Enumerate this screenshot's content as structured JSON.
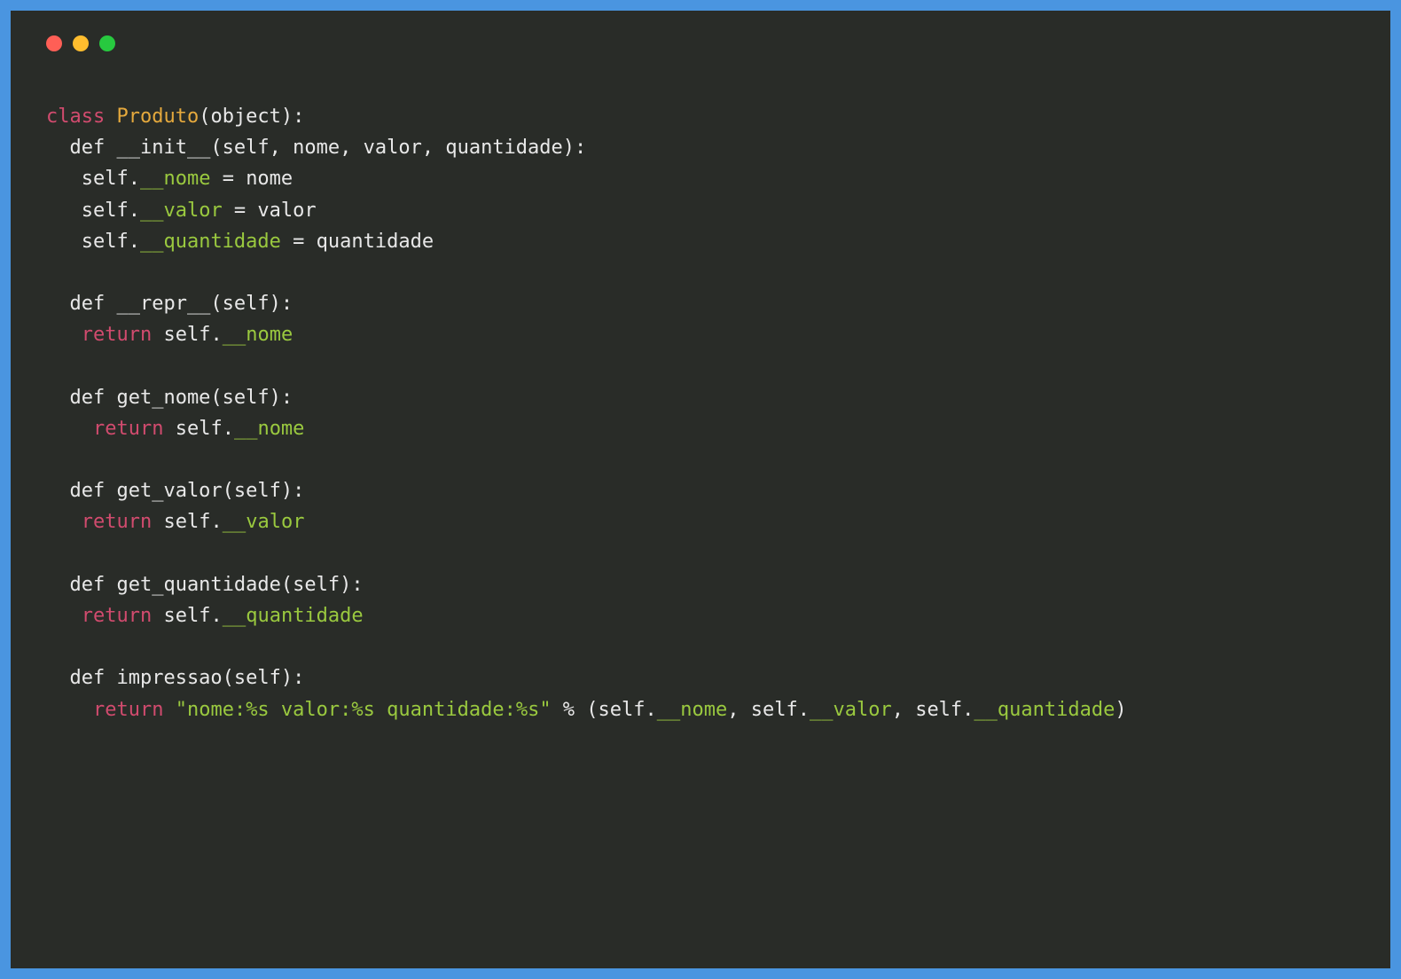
{
  "titlebar": {
    "close_color": "#ff5f56",
    "minimize_color": "#ffbd2e",
    "maximize_color": "#27c93f"
  },
  "code": {
    "tokens": [
      {
        "t": "class ",
        "c": "kw"
      },
      {
        "t": "Produto",
        "c": "classname"
      },
      {
        "t": "(object):",
        "c": ""
      },
      {
        "t": "\n",
        "c": ""
      },
      {
        "t": "  def __init__(self, nome, valor, quantidade):",
        "c": ""
      },
      {
        "t": "\n",
        "c": ""
      },
      {
        "t": "   self.",
        "c": ""
      },
      {
        "t": "__nome",
        "c": "attr"
      },
      {
        "t": " = nome",
        "c": ""
      },
      {
        "t": "\n",
        "c": ""
      },
      {
        "t": "   self.",
        "c": ""
      },
      {
        "t": "__valor",
        "c": "attr"
      },
      {
        "t": " = valor",
        "c": ""
      },
      {
        "t": "\n",
        "c": ""
      },
      {
        "t": "   self.",
        "c": ""
      },
      {
        "t": "__quantidade",
        "c": "attr"
      },
      {
        "t": " = quantidade",
        "c": ""
      },
      {
        "t": "\n",
        "c": ""
      },
      {
        "t": "\n",
        "c": ""
      },
      {
        "t": "  def __repr__(self):",
        "c": ""
      },
      {
        "t": "\n",
        "c": ""
      },
      {
        "t": "   ",
        "c": ""
      },
      {
        "t": "return",
        "c": "kw"
      },
      {
        "t": " self.",
        "c": ""
      },
      {
        "t": "__nome",
        "c": "attr"
      },
      {
        "t": "\n",
        "c": ""
      },
      {
        "t": "\n",
        "c": ""
      },
      {
        "t": "  def get_nome(self):",
        "c": ""
      },
      {
        "t": "\n",
        "c": ""
      },
      {
        "t": "    ",
        "c": ""
      },
      {
        "t": "return",
        "c": "kw"
      },
      {
        "t": " self.",
        "c": ""
      },
      {
        "t": "__nome",
        "c": "attr"
      },
      {
        "t": "\n",
        "c": ""
      },
      {
        "t": "\n",
        "c": ""
      },
      {
        "t": "  def get_valor(self):",
        "c": ""
      },
      {
        "t": "\n",
        "c": ""
      },
      {
        "t": "   ",
        "c": ""
      },
      {
        "t": "return",
        "c": "kw"
      },
      {
        "t": " self.",
        "c": ""
      },
      {
        "t": "__valor",
        "c": "attr"
      },
      {
        "t": "\n",
        "c": ""
      },
      {
        "t": "\n",
        "c": ""
      },
      {
        "t": "  def get_quantidade(self):",
        "c": ""
      },
      {
        "t": "\n",
        "c": ""
      },
      {
        "t": "   ",
        "c": ""
      },
      {
        "t": "return",
        "c": "kw"
      },
      {
        "t": " self.",
        "c": ""
      },
      {
        "t": "__quantidade",
        "c": "attr"
      },
      {
        "t": "\n",
        "c": ""
      },
      {
        "t": "\n",
        "c": ""
      },
      {
        "t": "  def impressao(self):",
        "c": ""
      },
      {
        "t": "\n",
        "c": ""
      },
      {
        "t": "    ",
        "c": ""
      },
      {
        "t": "return",
        "c": "kw"
      },
      {
        "t": " ",
        "c": ""
      },
      {
        "t": "\"nome:%s valor:%s quantidade:%s\"",
        "c": "str"
      },
      {
        "t": " % (self.",
        "c": ""
      },
      {
        "t": "__nome",
        "c": "attr"
      },
      {
        "t": ", self.",
        "c": ""
      },
      {
        "t": "__valor",
        "c": "attr"
      },
      {
        "t": ", self.",
        "c": ""
      },
      {
        "t": "__quantidade",
        "c": "attr"
      },
      {
        "t": ")",
        "c": ""
      }
    ]
  }
}
